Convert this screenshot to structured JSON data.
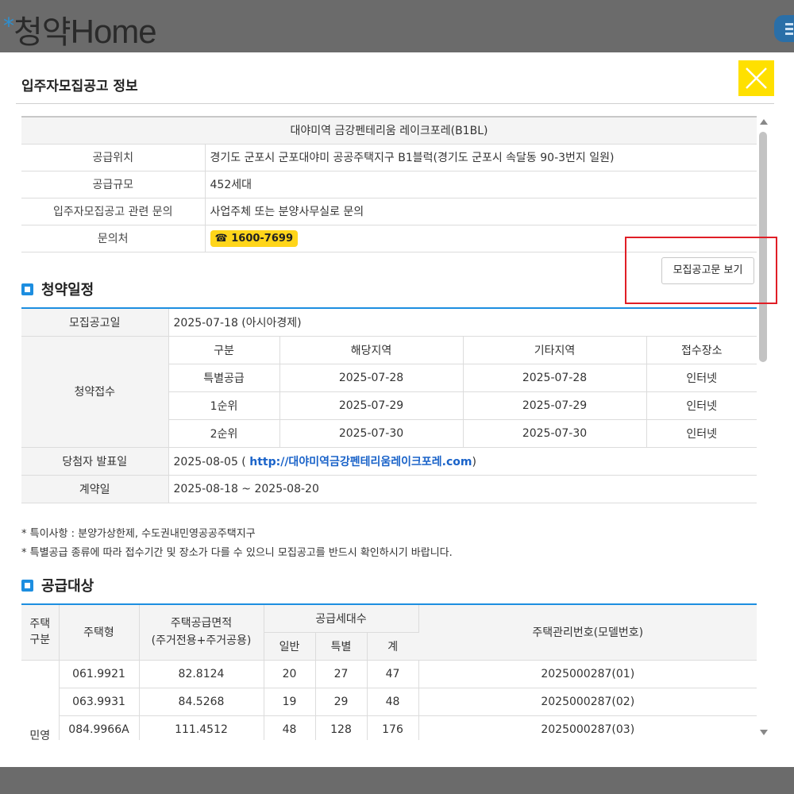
{
  "app": {
    "logo_star": "*",
    "logo_korean": "청약",
    "logo_home": "Home"
  },
  "modal": {
    "title": "입주자모집공고 정보"
  },
  "info": {
    "complex_name": "대야미역 금강펜테리움 레이크포레(B1BL)",
    "rows": [
      {
        "label": "공급위치",
        "value": "경기도 군포시 군포대야미 공공주택지구 B1블럭(경기도 군포시 속달동 90-3번지 일원)"
      },
      {
        "label": "공급규모",
        "value": "452세대"
      },
      {
        "label": "입주자모집공고 관련 문의",
        "value": "사업주체 또는 분양사무실로 문의"
      },
      {
        "label": "문의처",
        "phone_icon": "☎",
        "phone": "1600-7699"
      }
    ],
    "notice_button": "모집공고문 보기"
  },
  "schedule": {
    "section_title": "청약일정",
    "announce_label": "모집공고일",
    "announce_value": "2025-07-18 (아시아경제)",
    "receipt_label": "청약접수",
    "columns": [
      "구분",
      "해당지역",
      "기타지역",
      "접수장소"
    ],
    "rows": [
      {
        "type": "특별공급",
        "local": "2025-07-28",
        "other": "2025-07-28",
        "place": "인터넷"
      },
      {
        "type": "1순위",
        "local": "2025-07-29",
        "other": "2025-07-29",
        "place": "인터넷"
      },
      {
        "type": "2순위",
        "local": "2025-07-30",
        "other": "2025-07-30",
        "place": "인터넷"
      }
    ],
    "winner_label": "당첨자 발표일",
    "winner_date": "2025-08-05 (",
    "winner_link": "http://대야미역금강펜테리움레이크포레.com",
    "winner_close": ")",
    "contract_label": "계약일",
    "contract_value": "2025-08-18 ~ 2025-08-20"
  },
  "notes": [
    "* 특이사항 : 분양가상한제, 수도권내민영공공주택지구",
    "* 특별공급 종류에 따라 접수기간 및 장소가 다를 수 있으니 모집공고를 반드시 확인하시기 바랍니다."
  ],
  "supply": {
    "section_title": "공급대상",
    "headers": {
      "house_category": "주택\n구분",
      "house_type": "주택형",
      "area": "주택공급면적",
      "area_sub": "(주거전용+주거공용)",
      "households": "공급세대수",
      "general": "일반",
      "special": "특별",
      "total": "계",
      "mgmt_no": "주택관리번호(모델번호)"
    },
    "category_partial": "민영",
    "rows": [
      {
        "type": "061.9921",
        "area": "82.8124",
        "general": "20",
        "special": "27",
        "total": "47",
        "no": "2025000287(01)"
      },
      {
        "type": "063.9931",
        "area": "84.5268",
        "general": "19",
        "special": "29",
        "total": "48",
        "no": "2025000287(02)"
      },
      {
        "type": "084.9966A",
        "area": "111.4512",
        "general": "48",
        "special": "128",
        "total": "176",
        "no": "2025000287(03)"
      }
    ]
  },
  "colors": {
    "accent_blue": "#1d8ee0",
    "close_yellow": "#ffe000",
    "phone_yellow": "#ffd51a",
    "highlight_red": "#e01e26",
    "link_blue": "#1a63c9"
  }
}
